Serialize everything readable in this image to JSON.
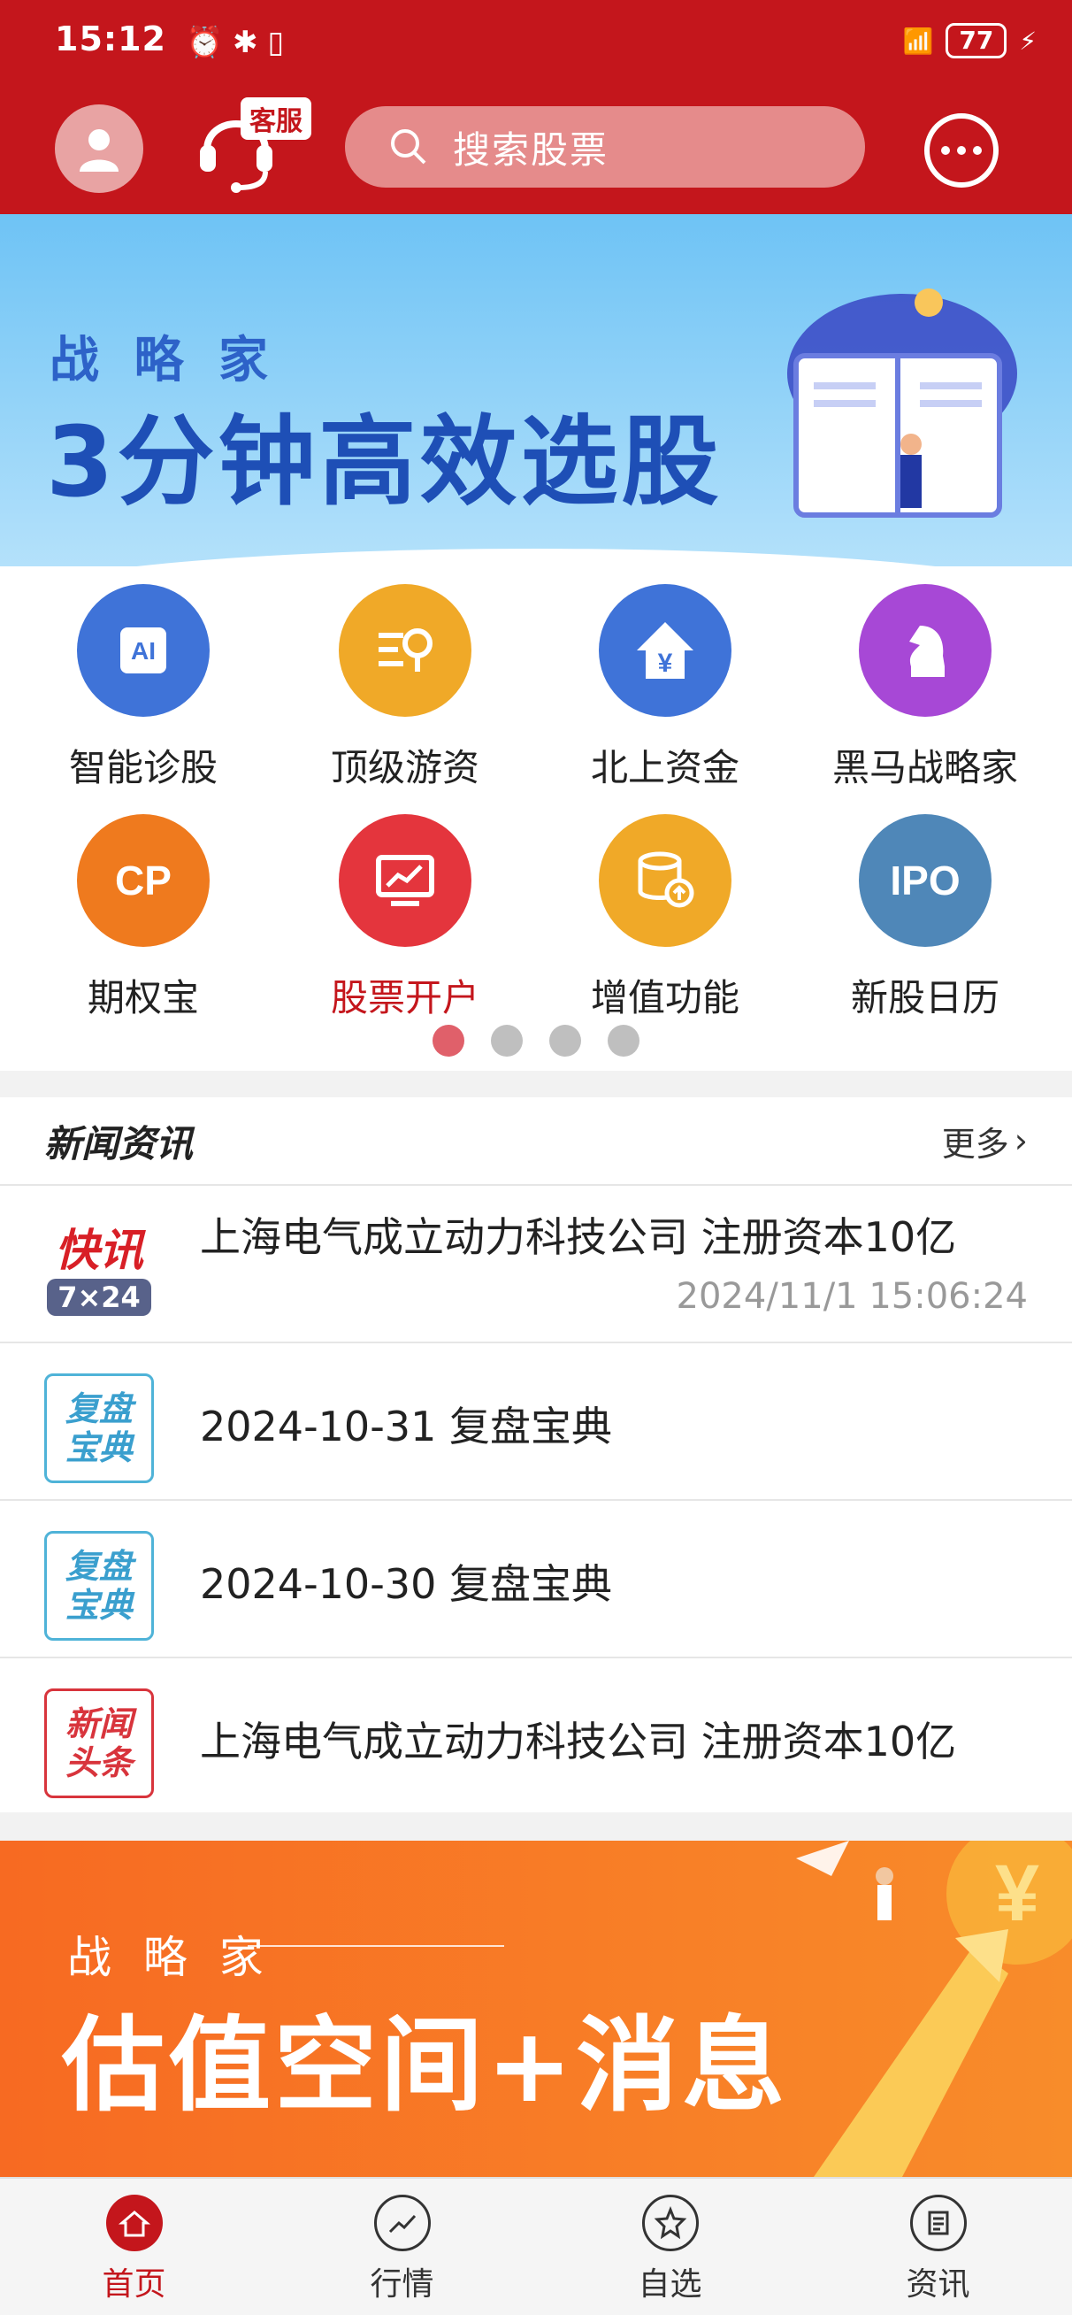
{
  "status_bar": {
    "time": "15:12",
    "battery": "77"
  },
  "header": {
    "kefu_badge": "客服",
    "search_placeholder": "搜索股票"
  },
  "banner_top": {
    "subtitle": "战 略 家",
    "title": "3分钟高效选股"
  },
  "menu": [
    {
      "label": "智能诊股",
      "icon": "ai-chip-icon",
      "color": "#3f73d8"
    },
    {
      "label": "顶级游资",
      "icon": "search-list-icon",
      "color": "#f0a928"
    },
    {
      "label": "北上资金",
      "icon": "yuan-house-icon",
      "color": "#3f73d8"
    },
    {
      "label": "黑马战略家",
      "icon": "chess-knight-icon",
      "color": "#a748d6"
    },
    {
      "label": "期权宝",
      "icon": "cp-icon",
      "color": "#ef7a1e"
    },
    {
      "label": "股票开户",
      "icon": "monitor-chart-icon",
      "color": "#e4353d"
    },
    {
      "label": "增值功能",
      "icon": "coin-stack-icon",
      "color": "#f0a928"
    },
    {
      "label": "新股日历",
      "icon": "ipo-icon",
      "color": "#4f87b8"
    }
  ],
  "news": {
    "title": "新闻资讯",
    "more": "更多",
    "items": [
      {
        "text": "上海电气成立动力科技公司 注册资本10亿",
        "time": "2024/11/1 15:06:24",
        "badge_top": "快讯",
        "badge_bottom": "7×24"
      },
      {
        "text": "2024-10-31 复盘宝典",
        "badge_top": "复盘",
        "badge_bottom": "宝典"
      },
      {
        "text": "2024-10-30 复盘宝典",
        "badge_top": "复盘",
        "badge_bottom": "宝典"
      },
      {
        "text": "上海电气成立动力科技公司 注册资本10亿",
        "badge_top": "新闻",
        "badge_bottom": "头条"
      }
    ]
  },
  "banner_bottom": {
    "subtitle": "战 略 家",
    "title": "估值空间+消息"
  },
  "bottom_nav": [
    {
      "label": "首页",
      "icon": "home-icon",
      "active": true
    },
    {
      "label": "行情",
      "icon": "trend-icon",
      "active": false
    },
    {
      "label": "自选",
      "icon": "star-icon",
      "active": false
    },
    {
      "label": "资讯",
      "icon": "news-icon",
      "active": false
    }
  ]
}
